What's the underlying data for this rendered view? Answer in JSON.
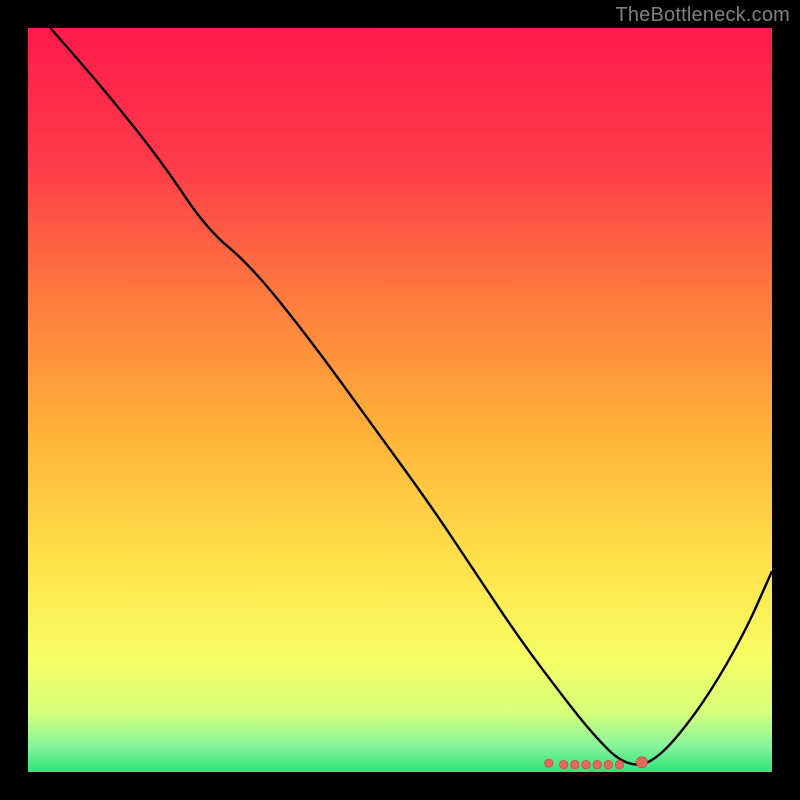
{
  "watermark": "TheBottleneck.com",
  "colors": {
    "page_bg": "#000000",
    "curve": "#000000",
    "watermark": "#808080",
    "marker_fill": "#e46a5e",
    "marker_stroke": "#c94f44",
    "gradient_stops": [
      {
        "offset": 0.0,
        "color": "#ff1a4b"
      },
      {
        "offset": 0.18,
        "color": "#ff3a4a"
      },
      {
        "offset": 0.36,
        "color": "#ff7a3e"
      },
      {
        "offset": 0.55,
        "color": "#ffb43a"
      },
      {
        "offset": 0.72,
        "color": "#ffe24a"
      },
      {
        "offset": 0.85,
        "color": "#f7ff66"
      },
      {
        "offset": 0.92,
        "color": "#d6ff7a"
      },
      {
        "offset": 0.965,
        "color": "#86f59a"
      },
      {
        "offset": 1.0,
        "color": "#2fe37a"
      }
    ]
  },
  "chart_data": {
    "type": "line",
    "title": "",
    "xlabel": "",
    "ylabel": "",
    "xlim": [
      0,
      100
    ],
    "ylim": [
      0,
      100
    ],
    "legend": false,
    "grid": false,
    "series": [
      {
        "name": "bottleneck-curve",
        "x": [
          3,
          10,
          18,
          24,
          30,
          38,
          46,
          54,
          60,
          66,
          72,
          76,
          80,
          84,
          90,
          96,
          100
        ],
        "y": [
          100,
          92,
          82,
          73,
          68,
          58,
          47,
          36,
          27,
          18,
          10,
          5,
          1,
          1,
          8,
          18,
          27
        ]
      }
    ],
    "markers": {
      "name": "highlight-cluster",
      "points": [
        {
          "x": 70,
          "y": 1.2
        },
        {
          "x": 72,
          "y": 1.0
        },
        {
          "x": 73.5,
          "y": 1.0
        },
        {
          "x": 75,
          "y": 1.0
        },
        {
          "x": 76.5,
          "y": 1.0
        },
        {
          "x": 78,
          "y": 1.0
        },
        {
          "x": 79.5,
          "y": 1.0
        },
        {
          "x": 82.5,
          "y": 1.3
        }
      ]
    }
  }
}
